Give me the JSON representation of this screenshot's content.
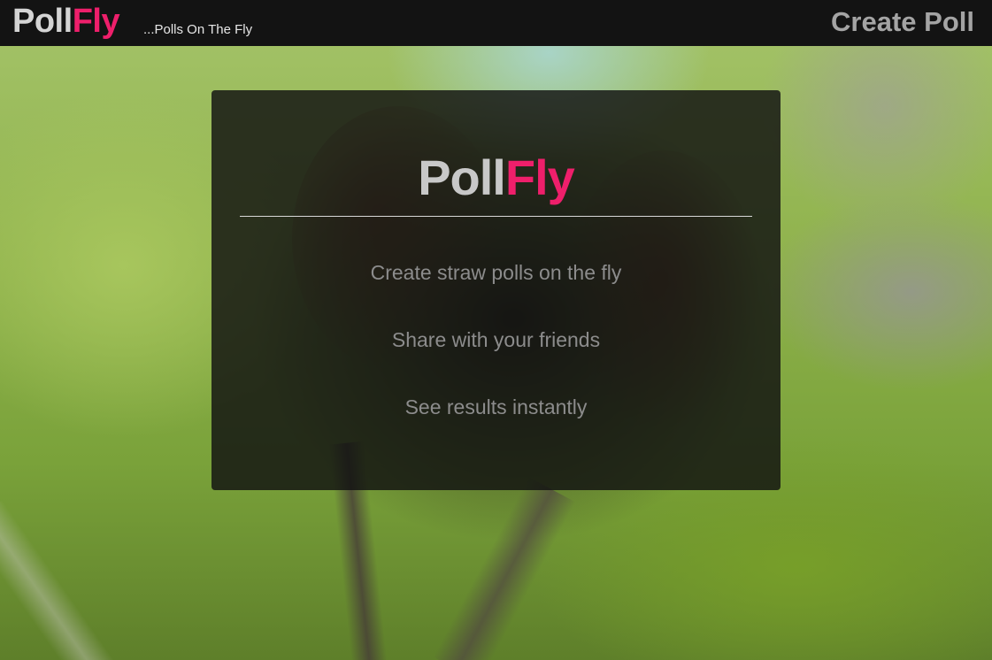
{
  "header": {
    "brand_part1": "Poll",
    "brand_part2": "Fly",
    "tagline": "...Polls On The Fly",
    "create_poll_label": "Create Poll"
  },
  "card": {
    "title_part1": "Poll",
    "title_part2": "Fly",
    "features": [
      "Create straw polls on the fly",
      "Share with your friends",
      "See results instantly"
    ]
  },
  "colors": {
    "accent": "#ee1f6b",
    "topbar_background": "#131313",
    "card_background": "#111111"
  }
}
